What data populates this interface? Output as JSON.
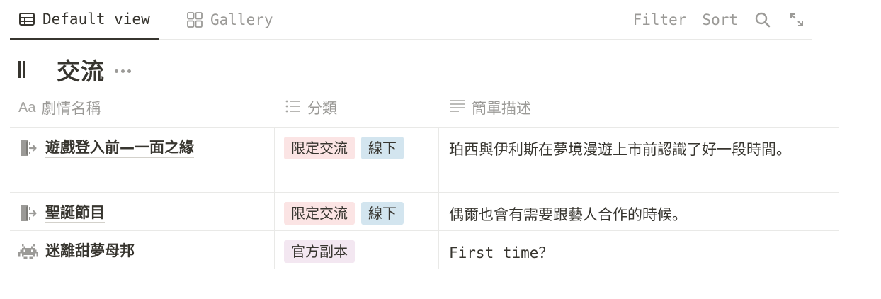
{
  "tabs": [
    {
      "label": "Default view",
      "icon": "table-icon",
      "active": true
    },
    {
      "label": "Gallery",
      "icon": "gallery-icon",
      "active": false
    }
  ],
  "actions": {
    "filter": "Filter",
    "sort": "Sort",
    "search_icon": "search-icon",
    "expand_icon": "expand-icon"
  },
  "group": {
    "title": "交流",
    "more_icon": "more-icon"
  },
  "columns": [
    {
      "label": "劇情名稱",
      "icon": "Aa"
    },
    {
      "label": "分類",
      "icon": "list-icon"
    },
    {
      "label": "簡單描述",
      "icon": "text-icon"
    }
  ],
  "rows": [
    {
      "icon": "door-exit-icon",
      "name": "遊戲登入前—一面之緣",
      "tags": [
        "限定交流",
        "線下"
      ],
      "desc": "珀西與伊利斯在夢境漫遊上市前認識了好一段時間。"
    },
    {
      "icon": "door-exit-icon",
      "name": "聖誕節目",
      "tags": [
        "限定交流",
        "線下"
      ],
      "desc": "偶爾也會有需要跟藝人合作的時候。"
    },
    {
      "icon": "space-invader-icon",
      "name": "迷離甜夢母邦",
      "tags": [
        "官方副本"
      ],
      "desc": "First time？"
    }
  ],
  "colors": {
    "tag_pink": "#fbe4e4",
    "tag_blue": "#d3e5ef",
    "tag_purple": "#f3e7f1",
    "text": "#37352f",
    "muted": "#9b9a97"
  }
}
